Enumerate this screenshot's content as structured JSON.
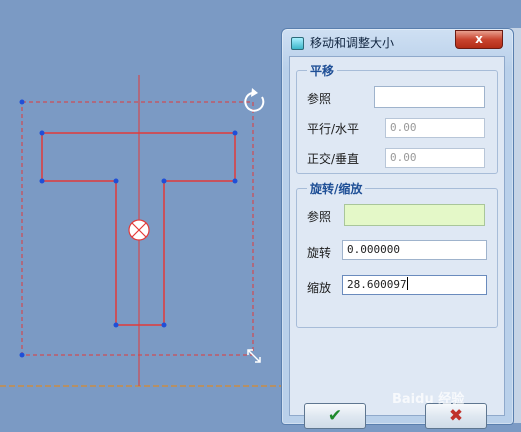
{
  "dialog": {
    "title": "移动和调整大小",
    "close_glyph": "x",
    "translate_group": {
      "title": "平移",
      "reference_label": "参照",
      "reference_value": "",
      "parallel_label": "平行/水平",
      "parallel_value": "0.00",
      "normal_label": "正交/垂直",
      "normal_value": "0.00"
    },
    "rotate_group": {
      "title": "旋转/缩放",
      "reference_label": "参照",
      "reference_value": "",
      "rotate_label": "旋转",
      "rotate_value": "0.000000",
      "scale_label": "缩放",
      "scale_value": "28.600097"
    },
    "ok_glyph": "✔",
    "cancel_glyph": "✖",
    "colors": {
      "ok": "#1e8a2c",
      "cancel": "#c0322b",
      "title_bar": "#b9d0ea"
    }
  },
  "canvas": {
    "colors": {
      "background": "#7b9ac4",
      "sketch": "#e23a3a",
      "vertex": "#1f4fd8",
      "baseline": "#d98a2a"
    },
    "icons": [
      "rotate-handle-icon",
      "scale-handle-icon",
      "center-point-icon"
    ]
  },
  "watermark": "Baidu 经验"
}
